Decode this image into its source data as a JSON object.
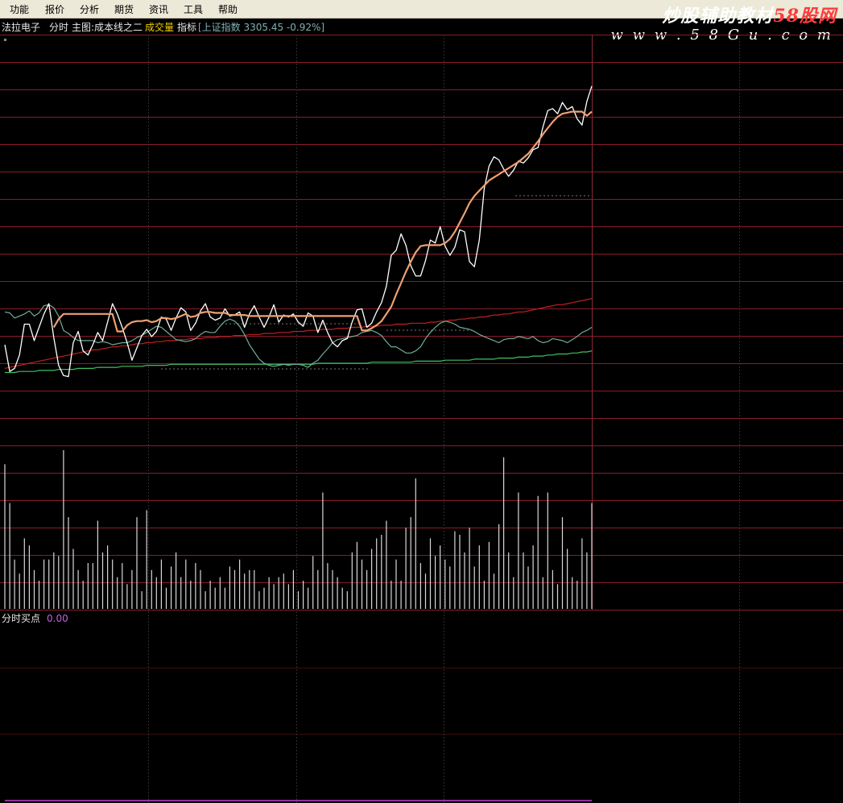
{
  "menu": {
    "items": [
      "功能",
      "报价",
      "分析",
      "期货",
      "资讯",
      "工具",
      "帮助"
    ]
  },
  "watermark": {
    "line1_main": "炒股辅助教材",
    "line1_accent": "58股网",
    "line2": "w w w . 5 8 G u . c o m"
  },
  "info_bar": {
    "stock_name": "法拉电子",
    "mode": "分时",
    "main_indicator": "主图:成本线之二",
    "volume_label": "成交量",
    "indicator_label": "指标",
    "index_quote": "[上证指数 3305.45 -0.92%]"
  },
  "sub_panel": {
    "title": "分时买点",
    "value": "0.00"
  },
  "colors": {
    "background": "#000000",
    "grid_h": "#8a1c2a",
    "grid_v": "#2e2e2e",
    "price": "#ffffff",
    "avg": "#f0a070",
    "teal_line": "#6fae9a",
    "red_line": "#c02020",
    "green_line": "#40c060",
    "volume": "#d8d8d8",
    "signal": "#c040d0"
  },
  "chart_data": {
    "type": "line",
    "x": [
      0,
      1,
      2,
      3,
      4,
      5,
      6,
      7,
      8,
      9,
      10,
      11,
      12,
      13,
      14,
      15,
      16,
      17,
      18,
      19,
      20,
      21,
      22,
      23,
      24,
      25,
      26,
      27,
      28,
      29,
      30,
      31,
      32,
      33,
      34,
      35,
      36,
      37,
      38,
      39,
      40,
      41,
      42,
      43,
      44,
      45,
      46,
      47,
      48,
      49,
      50,
      51,
      52,
      53,
      54,
      55,
      56,
      57,
      58,
      59,
      60,
      61,
      62,
      63,
      64,
      65,
      66,
      67,
      68,
      69,
      70,
      71,
      72,
      73,
      74,
      75,
      76,
      77,
      78,
      79,
      80,
      81,
      82,
      83,
      84,
      85,
      86,
      87,
      88,
      89,
      90,
      91,
      92,
      93,
      94,
      95,
      96,
      97,
      98,
      99,
      100,
      101,
      102,
      103,
      104,
      105,
      106,
      107,
      108,
      109,
      110,
      111,
      112,
      113,
      114,
      115,
      116,
      117,
      118,
      119,
      120
    ],
    "series": [
      {
        "role": "price",
        "values": [
          9.8,
          7.2,
          7.5,
          8.8,
          11.8,
          11.8,
          10.2,
          11.5,
          12.8,
          13.8,
          10.5,
          7.8,
          6.8,
          6.7,
          10.0,
          11.1,
          9.2,
          8.8,
          9.8,
          11.0,
          10.2,
          12.0,
          13.8,
          12.8,
          11.5,
          10.0,
          8.3,
          9.5,
          10.7,
          11.3,
          10.6,
          11.1,
          12.5,
          12.3,
          11.2,
          12.4,
          13.4,
          13.0,
          11.2,
          11.9,
          13.1,
          13.8,
          12.5,
          12.2,
          12.4,
          13.3,
          12.6,
          12.7,
          13.0,
          11.5,
          12.8,
          13.6,
          12.5,
          11.5,
          12.5,
          13.7,
          12.0,
          12.7,
          12.5,
          12.8,
          12.0,
          11.6,
          12.9,
          12.6,
          11.0,
          12.2,
          11.0,
          10.0,
          9.6,
          10.2,
          10.4,
          12.0,
          13.2,
          13.3,
          11.5,
          11.9,
          13.0,
          13.9,
          15.5,
          18.5,
          19.0,
          20.6,
          19.5,
          17.5,
          16.5,
          16.5,
          18.0,
          20.0,
          19.7,
          21.3,
          19.4,
          18.5,
          19.3,
          21.0,
          20.8,
          17.9,
          17.4,
          20.0,
          25.0,
          27.2,
          28.1,
          27.8,
          26.9,
          26.2,
          26.8,
          27.7,
          27.5,
          28.0,
          28.8,
          29.0,
          31.0,
          32.6,
          32.8,
          32.3,
          33.4,
          32.7,
          33.0,
          31.8,
          31.2,
          33.5,
          35.0
        ],
        "avg_values": [
          null,
          null,
          null,
          null,
          null,
          null,
          null,
          null,
          null,
          null,
          11.5,
          12.3,
          12.8,
          12.8,
          12.8,
          12.8,
          12.8,
          12.8,
          12.8,
          12.8,
          12.8,
          12.8,
          12.8,
          11.1,
          11.1,
          11.7,
          12.0,
          12.1,
          12.1,
          12.2,
          12.0,
          12.1,
          12.4,
          12.4,
          12.3,
          12.4,
          12.6,
          12.8,
          12.5,
          12.6,
          12.9,
          13.0,
          13.0,
          12.9,
          12.9,
          12.9,
          12.7,
          12.7,
          12.7,
          12.7,
          12.6,
          12.6,
          12.6,
          12.6,
          12.6,
          12.6,
          12.6,
          12.6,
          12.6,
          12.6,
          12.6,
          12.6,
          12.6,
          12.6,
          12.6,
          12.6,
          12.6,
          12.6,
          12.6,
          12.6,
          12.6,
          12.6,
          12.6,
          11.2,
          11.2,
          11.4,
          11.7,
          12.1,
          12.8,
          13.5,
          14.7,
          15.8,
          16.9,
          17.9,
          18.8,
          19.4,
          19.5,
          19.5,
          19.5,
          19.5,
          19.7,
          20.1,
          20.8,
          21.7,
          22.6,
          23.6,
          24.3,
          24.8,
          25.3,
          25.8,
          26.1,
          26.4,
          26.7,
          27.0,
          27.3,
          27.6,
          28.0,
          28.4,
          29.0,
          29.6,
          30.3,
          30.9,
          31.5,
          32.0,
          32.3,
          32.4,
          32.5,
          32.5,
          32.5,
          32.1,
          32.5
        ]
      },
      {
        "role": "teal",
        "values": [
          13.0,
          12.9,
          12.4,
          12.6,
          12.8,
          13.1,
          12.6,
          12.9,
          13.6,
          13.7,
          13.4,
          12.6,
          11.2,
          10.9,
          10.5,
          10.2,
          10.2,
          10.2,
          10.2,
          10.0,
          10.1,
          10.0,
          9.8,
          9.9,
          10.0,
          10.0,
          10.2,
          10.5,
          10.7,
          11.0,
          11.3,
          11.6,
          11.5,
          11.1,
          10.7,
          10.3,
          10.2,
          10.1,
          10.2,
          10.4,
          10.8,
          11.1,
          11.0,
          11.0,
          11.6,
          12.1,
          12.3,
          12.1,
          11.6,
          10.8,
          9.8,
          9.1,
          8.4,
          8.0,
          7.8,
          7.7,
          7.8,
          7.9,
          7.8,
          7.9,
          7.9,
          7.8,
          7.6,
          8.0,
          8.3,
          8.9,
          9.4,
          10.0,
          10.3,
          10.4,
          10.5,
          10.6,
          10.7,
          11.0,
          11.1,
          11.2,
          11.0,
          10.7,
          10.1,
          9.6,
          9.6,
          9.3,
          9.0,
          9.0,
          9.2,
          9.6,
          10.4,
          11.0,
          11.5,
          11.9,
          12.1,
          12.0,
          11.8,
          11.5,
          11.4,
          11.3,
          11.1,
          10.8,
          10.6,
          10.4,
          10.2,
          10.0,
          10.3,
          10.4,
          10.4,
          10.6,
          10.5,
          10.4,
          10.6,
          10.2,
          10.0,
          10.1,
          10.4,
          10.3,
          10.2,
          10.0,
          10.3,
          10.6,
          11.0,
          11.2,
          11.5
        ]
      },
      {
        "role": "red",
        "values": [
          7.5,
          7.6,
          7.7,
          7.8,
          7.9,
          8.0,
          8.1,
          8.2,
          8.3,
          8.4,
          8.5,
          8.6,
          8.7,
          8.8,
          8.9,
          9.0,
          9.1,
          9.2,
          9.3,
          9.3,
          9.4,
          9.5,
          9.6,
          9.6,
          9.7,
          9.7,
          9.8,
          9.9,
          9.9,
          10.0,
          10.0,
          10.1,
          10.1,
          10.2,
          10.2,
          10.2,
          10.3,
          10.3,
          10.4,
          10.4,
          10.4,
          10.5,
          10.5,
          10.5,
          10.6,
          10.6,
          10.6,
          10.7,
          10.7,
          10.7,
          10.8,
          10.8,
          10.8,
          10.9,
          10.9,
          10.9,
          11.0,
          11.0,
          11.0,
          11.1,
          11.1,
          11.1,
          11.2,
          11.2,
          11.2,
          11.3,
          11.3,
          11.3,
          11.4,
          11.4,
          11.4,
          11.5,
          11.5,
          11.5,
          11.6,
          11.6,
          11.6,
          11.7,
          11.7,
          11.7,
          11.8,
          11.8,
          11.8,
          11.9,
          11.9,
          11.9,
          11.9,
          12.0,
          12.0,
          12.1,
          12.1,
          12.2,
          12.2,
          12.3,
          12.3,
          12.4,
          12.4,
          12.5,
          12.5,
          12.6,
          12.7,
          12.7,
          12.8,
          12.8,
          12.9,
          13.0,
          13.0,
          13.1,
          13.2,
          13.3,
          13.4,
          13.5,
          13.6,
          13.7,
          13.7,
          13.8,
          13.9,
          14.0,
          14.1,
          14.2,
          14.3
        ]
      },
      {
        "role": "green",
        "values": [
          7.1,
          7.1,
          7.1,
          7.2,
          7.2,
          7.2,
          7.2,
          7.3,
          7.3,
          7.3,
          7.3,
          7.4,
          7.4,
          7.4,
          7.4,
          7.5,
          7.5,
          7.5,
          7.5,
          7.6,
          7.6,
          7.6,
          7.6,
          7.6,
          7.7,
          7.7,
          7.7,
          7.7,
          7.7,
          7.8,
          7.8,
          7.8,
          7.8,
          7.8,
          7.9,
          7.9,
          7.9,
          7.9,
          7.9,
          7.9,
          7.9,
          7.9,
          7.9,
          7.9,
          7.9,
          7.9,
          7.9,
          7.9,
          7.9,
          7.9,
          7.9,
          7.9,
          7.9,
          7.9,
          7.9,
          7.9,
          7.9,
          7.9,
          7.9,
          7.9,
          7.9,
          7.9,
          7.9,
          7.9,
          8.0,
          8.0,
          8.0,
          8.0,
          8.0,
          8.0,
          8.0,
          8.0,
          8.0,
          8.0,
          8.0,
          8.1,
          8.1,
          8.1,
          8.1,
          8.1,
          8.1,
          8.1,
          8.1,
          8.1,
          8.2,
          8.2,
          8.2,
          8.2,
          8.2,
          8.2,
          8.3,
          8.3,
          8.3,
          8.3,
          8.3,
          8.3,
          8.4,
          8.4,
          8.4,
          8.4,
          8.4,
          8.5,
          8.5,
          8.5,
          8.5,
          8.6,
          8.6,
          8.6,
          8.7,
          8.7,
          8.7,
          8.8,
          8.8,
          8.9,
          8.9,
          8.9,
          9.0,
          9.0,
          9.1,
          9.1,
          9.2
        ]
      }
    ],
    "ylim": [
      0,
      40
    ],
    "volume": [
      41,
      30,
      14,
      10,
      20,
      18,
      11,
      8,
      14,
      14,
      16,
      15,
      45,
      26,
      17,
      11,
      8,
      13,
      13,
      25,
      16,
      18,
      14,
      9,
      13,
      7,
      11,
      26,
      5,
      28,
      11,
      9,
      14,
      6,
      12,
      16,
      9,
      14,
      8,
      13,
      11,
      5,
      8,
      6,
      9,
      6,
      12,
      11,
      14,
      10,
      11,
      11,
      5,
      6,
      9,
      7,
      9,
      10,
      7,
      11,
      5,
      8,
      6,
      15,
      11,
      33,
      13,
      11,
      9,
      6,
      5,
      16,
      19,
      14,
      11,
      17,
      20,
      21,
      25,
      8,
      14,
      8,
      23,
      26,
      37,
      13,
      10,
      20,
      15,
      18,
      14,
      12,
      22,
      21,
      16,
      23,
      12,
      18,
      8,
      19,
      10,
      24,
      43,
      16,
      9,
      33,
      16,
      12,
      18,
      32,
      9,
      33,
      11,
      7,
      26,
      17,
      9,
      8,
      20,
      16,
      30
    ],
    "signal": [
      0,
      0,
      0,
      0,
      0,
      0,
      0,
      0,
      0,
      0,
      0,
      0,
      0,
      0,
      0,
      0,
      0,
      0,
      0,
      0,
      0,
      0,
      0,
      0,
      0,
      0,
      0,
      0,
      0,
      0,
      0,
      0,
      0,
      0,
      0,
      0,
      0,
      0,
      0,
      0,
      0,
      0,
      0,
      0,
      0,
      0,
      0,
      0,
      0,
      0,
      0,
      0,
      0,
      0,
      0,
      0,
      0,
      0,
      0,
      0,
      0,
      0,
      0,
      0,
      0,
      0,
      0,
      0,
      0,
      0,
      0,
      0,
      0,
      0,
      0,
      0,
      0,
      0,
      0,
      0,
      0,
      0,
      0,
      0,
      0,
      0,
      0,
      0,
      0,
      0,
      0,
      0,
      0,
      0,
      0,
      0,
      0,
      0,
      0,
      0,
      0,
      0,
      0,
      0,
      0,
      0,
      0,
      0,
      0,
      0,
      0,
      0,
      0,
      0,
      0,
      0,
      0,
      0,
      0,
      0,
      0
    ]
  }
}
